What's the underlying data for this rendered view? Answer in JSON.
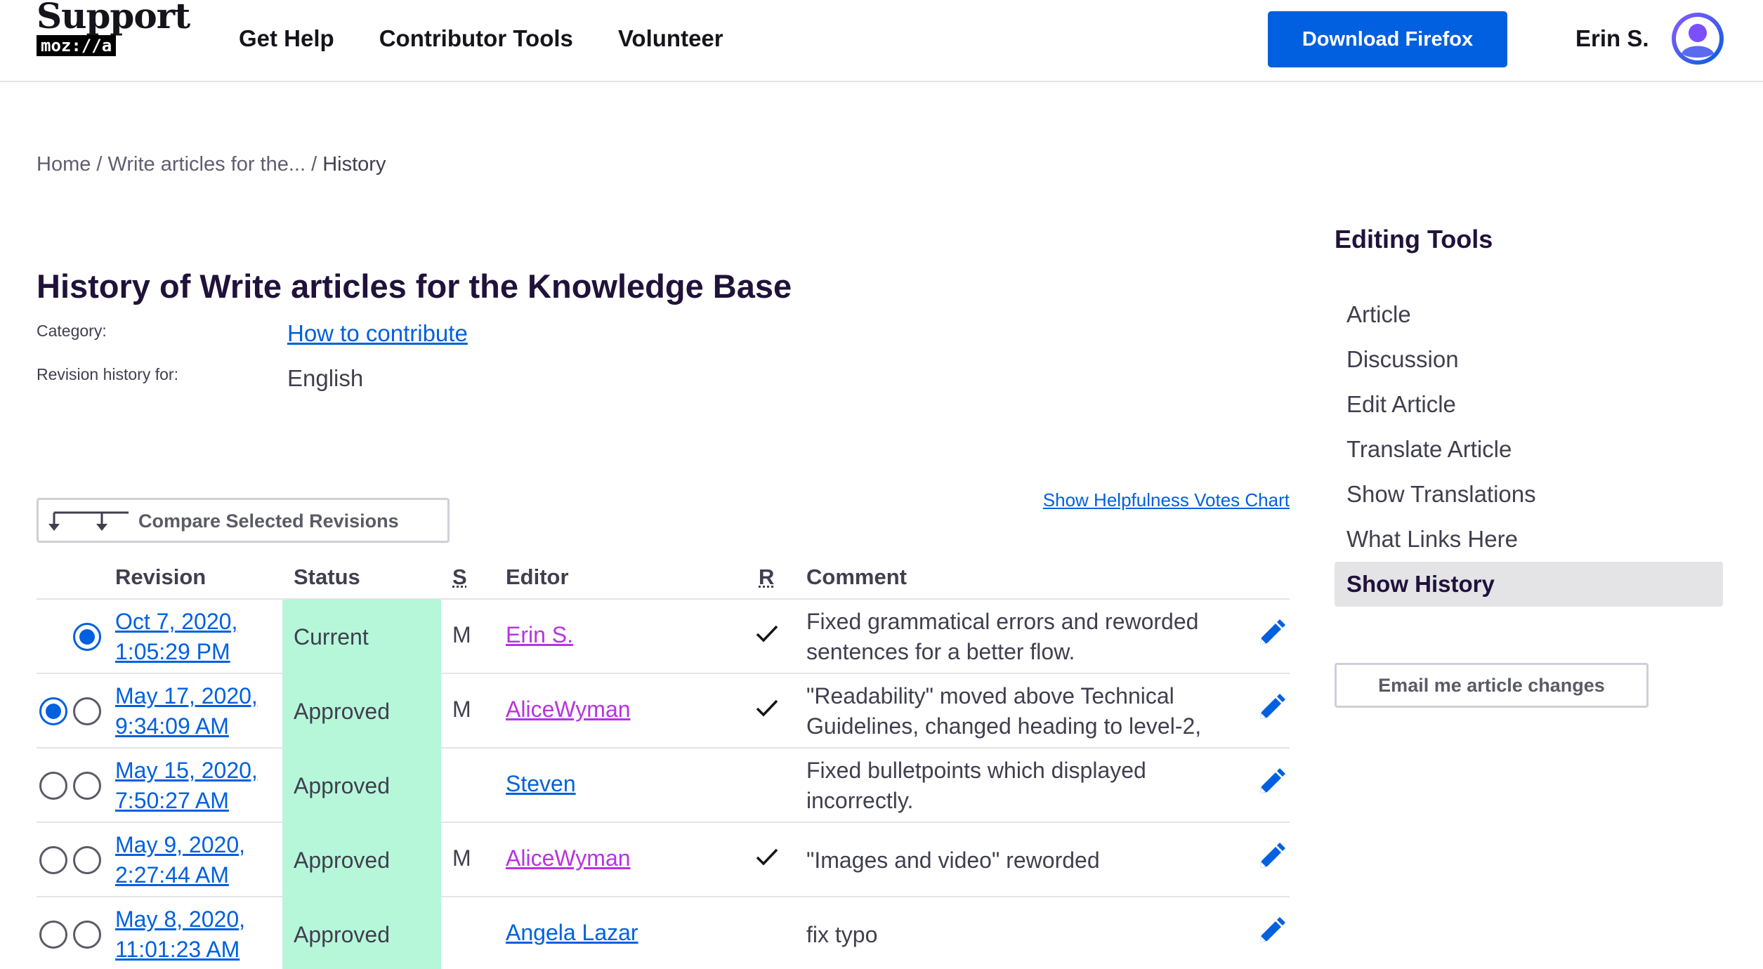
{
  "header": {
    "logo_word": "Support",
    "logo_brand": "moz://a",
    "nav": [
      "Get Help",
      "Contributor Tools",
      "Volunteer"
    ],
    "download_label": "Download Firefox",
    "username": "Erin S."
  },
  "breadcrumb": {
    "home": "Home",
    "parent": "Write articles for the...",
    "current": "History",
    "separator": "/"
  },
  "page": {
    "title": "History of Write articles for the Knowledge Base",
    "category_label": "Category:",
    "category_value": "How to contribute",
    "revision_label": "Revision history for:",
    "revision_value": "English"
  },
  "compare": {
    "label": "Compare Selected Revisions",
    "votes_link": "Show Helpfulness Votes Chart"
  },
  "table": {
    "headers": {
      "revision": "Revision",
      "status": "Status",
      "s": "S",
      "editor": "Editor",
      "r": "R",
      "comment": "Comment"
    },
    "rows": [
      {
        "date_line1": "Oct 7, 2020,",
        "date_line2": "1:05:29 PM",
        "status": "Current",
        "s": "M",
        "editor": "Erin S.",
        "reviewed": true,
        "comment": "Fixed grammatical errors and reworded sentences for a better flow.",
        "radio_left": null,
        "radio_right": true
      },
      {
        "date_line1": "May 17, 2020,",
        "date_line2": "9:34:09 AM",
        "status": "Approved",
        "s": "M",
        "editor": "AliceWyman",
        "reviewed": true,
        "comment": "\"Readability\" moved above Technical Guidelines, changed heading to level-2,",
        "radio_left": true,
        "radio_right": false
      },
      {
        "date_line1": "May 15, 2020,",
        "date_line2": "7:50:27 AM",
        "status": "Approved",
        "s": "",
        "editor": "Steven",
        "reviewed": false,
        "comment": "Fixed bulletpoints which displayed incorrectly.",
        "radio_left": false,
        "radio_right": false
      },
      {
        "date_line1": "May 9, 2020,",
        "date_line2": "2:27:44 AM",
        "status": "Approved",
        "s": "M",
        "editor": "AliceWyman",
        "reviewed": true,
        "comment": "\"Images and video\" reworded",
        "radio_left": false,
        "radio_right": false
      },
      {
        "date_line1": "May 8, 2020,",
        "date_line2": "11:01:23 AM",
        "status": "Approved",
        "s": "",
        "editor": "Angela Lazar",
        "reviewed": false,
        "comment": "fix typo",
        "radio_left": false,
        "radio_right": false
      }
    ]
  },
  "sidebar": {
    "title": "Editing Tools",
    "items": [
      "Article",
      "Discussion",
      "Edit Article",
      "Translate Article",
      "Show Translations",
      "What Links Here",
      "Show History"
    ],
    "active_item": "Show History",
    "email_button": "Email me article changes"
  },
  "colors": {
    "accent": "#0060df",
    "visited": "#b833e1",
    "status_bg": "#b6f7d9",
    "avatar_gradient_start": "#9059ff"
  }
}
